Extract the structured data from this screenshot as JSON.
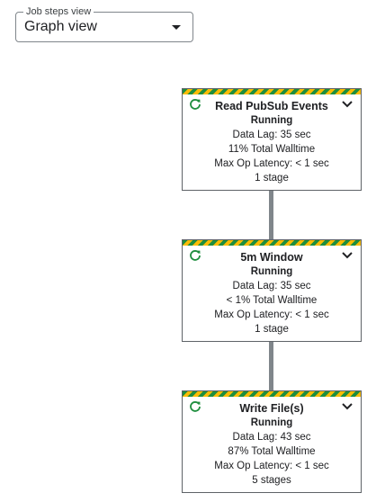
{
  "job_steps": {
    "legend": "Job steps view",
    "selected": "Graph view"
  },
  "nodes": [
    {
      "title": "Read PubSub Events",
      "status": "Running",
      "data_lag": "Data Lag: 35 sec",
      "walltime": "11% Total Walltime",
      "latency": "Max Op Latency: < 1 sec",
      "stages": "1 stage"
    },
    {
      "title": "5m Window",
      "status": "Running",
      "data_lag": "Data Lag: 35 sec",
      "walltime": "< 1% Total Walltime",
      "latency": "Max Op Latency: < 1 sec",
      "stages": "1 stage"
    },
    {
      "title": "Write File(s)",
      "status": "Running",
      "data_lag": "Data Lag: 43 sec",
      "walltime": "87% Total Walltime",
      "latency": "Max Op Latency: < 1 sec",
      "stages": "5 stages"
    }
  ],
  "icons": {
    "status": "running-refresh-icon",
    "expand": "chevron-down-icon"
  },
  "colors": {
    "running_green": "#1e8e3e",
    "stripe_yellow": "#fbbc04",
    "connector": "#80868b"
  }
}
